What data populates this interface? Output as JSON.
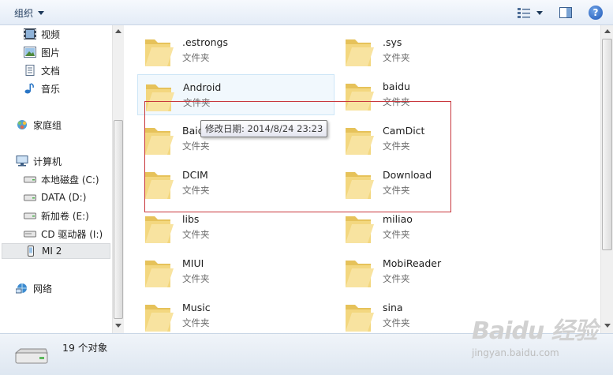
{
  "toolbar": {
    "organize_label": "组织"
  },
  "sidebar": {
    "items": [
      {
        "label": "视频",
        "icon": "video-icon"
      },
      {
        "label": "图片",
        "icon": "picture-icon"
      },
      {
        "label": "文档",
        "icon": "document-icon"
      },
      {
        "label": "音乐",
        "icon": "music-icon"
      },
      {
        "label": "家庭组",
        "icon": "homegroup-icon"
      },
      {
        "label": "计算机",
        "icon": "computer-icon"
      },
      {
        "label": "本地磁盘 (C:)",
        "icon": "drive-icon"
      },
      {
        "label": "DATA (D:)",
        "icon": "drive-icon"
      },
      {
        "label": "新加卷 (E:)",
        "icon": "drive-icon"
      },
      {
        "label": "CD 驱动器 (I:)",
        "icon": "cd-drive-icon"
      },
      {
        "label": "MI 2",
        "icon": "phone-icon",
        "selected": true
      },
      {
        "label": "网络",
        "icon": "network-icon"
      }
    ]
  },
  "folders": [
    {
      "name": ".estrongs",
      "type": "文件夹"
    },
    {
      "name": ".sys",
      "type": "文件夹"
    },
    {
      "name": "Android",
      "type": "文件夹"
    },
    {
      "name": "baidu",
      "type": "文件夹"
    },
    {
      "name": "Baid",
      "type": "文件夹"
    },
    {
      "name": "CamDict",
      "type": "文件夹"
    },
    {
      "name": "DCIM",
      "type": "文件夹"
    },
    {
      "name": "Download",
      "type": "文件夹"
    },
    {
      "name": "libs",
      "type": "文件夹"
    },
    {
      "name": "miliao",
      "type": "文件夹"
    },
    {
      "name": "MIUI",
      "type": "文件夹"
    },
    {
      "name": "MobiReader",
      "type": "文件夹"
    },
    {
      "name": "Music",
      "type": "文件夹"
    },
    {
      "name": "sina",
      "type": "文件夹"
    }
  ],
  "tooltip": {
    "text": "修改日期: 2014/8/24 23:23"
  },
  "status": {
    "count_text": "19 个对象"
  },
  "watermark": {
    "brand": "Baidu 经验",
    "sub": "jingyan.baidu.com"
  },
  "colors": {
    "annotation_box": "#c8363c",
    "folder": "#f3d77f",
    "toolbar": "#e4ecf7"
  }
}
